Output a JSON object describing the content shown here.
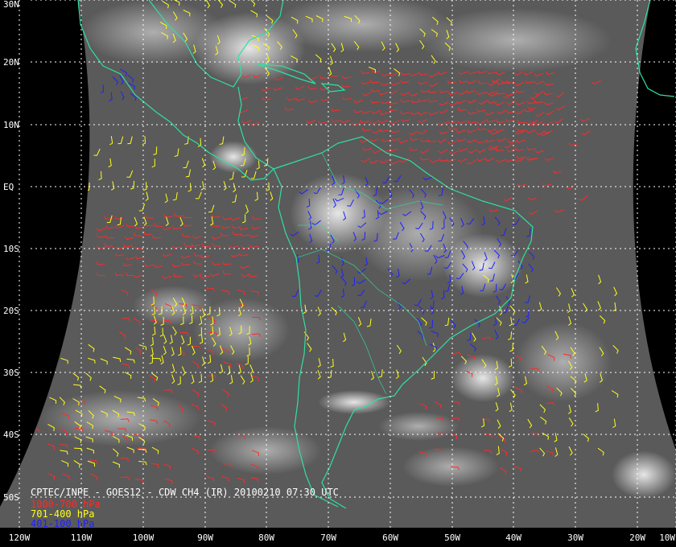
{
  "title": "CPTEC/INPE - GOES12 - CDW CH4 (IR) 20100210 07:30 UTC",
  "legend": [
    {
      "label": "1000-700 hPa",
      "color": "#ff2a2a"
    },
    {
      "label": "701-400 hPa",
      "color": "#ffff1a"
    },
    {
      "label": "401-100 hPa",
      "color": "#2020ff"
    }
  ],
  "colors": {
    "background": "#000000",
    "coastline": "#2fe0a0",
    "grid": "#ffffff",
    "label": "#ffffff"
  },
  "lat_labels": [
    "30N",
    "20N",
    "10N",
    "EQ",
    "10S",
    "20S",
    "30S",
    "40S",
    "50S"
  ],
  "lon_labels": [
    "120W",
    "110W",
    "100W",
    "90W",
    "80W",
    "70W",
    "60W",
    "50W",
    "40W",
    "30W",
    "20W",
    "10W"
  ]
}
